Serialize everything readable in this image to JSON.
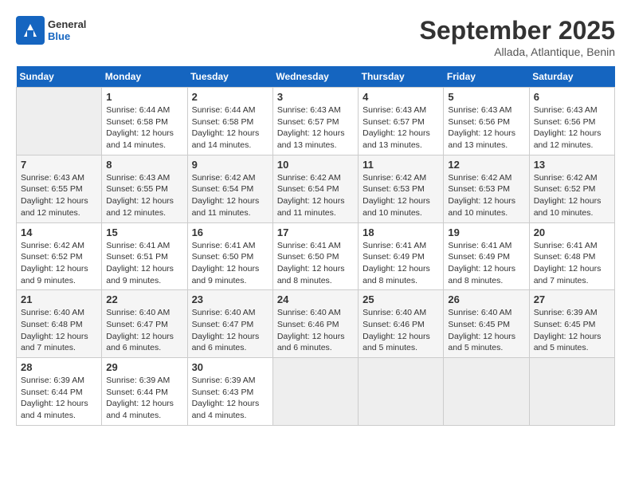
{
  "header": {
    "logo_line1": "General",
    "logo_line2": "Blue",
    "month": "September 2025",
    "location": "Allada, Atlantique, Benin"
  },
  "days_of_week": [
    "Sunday",
    "Monday",
    "Tuesday",
    "Wednesday",
    "Thursday",
    "Friday",
    "Saturday"
  ],
  "weeks": [
    [
      {
        "day": null
      },
      {
        "day": 1,
        "sunrise": "6:44 AM",
        "sunset": "6:58 PM",
        "daylight": "12 hours and 14 minutes."
      },
      {
        "day": 2,
        "sunrise": "6:44 AM",
        "sunset": "6:58 PM",
        "daylight": "12 hours and 14 minutes."
      },
      {
        "day": 3,
        "sunrise": "6:43 AM",
        "sunset": "6:57 PM",
        "daylight": "12 hours and 13 minutes."
      },
      {
        "day": 4,
        "sunrise": "6:43 AM",
        "sunset": "6:57 PM",
        "daylight": "12 hours and 13 minutes."
      },
      {
        "day": 5,
        "sunrise": "6:43 AM",
        "sunset": "6:56 PM",
        "daylight": "12 hours and 13 minutes."
      },
      {
        "day": 6,
        "sunrise": "6:43 AM",
        "sunset": "6:56 PM",
        "daylight": "12 hours and 12 minutes."
      }
    ],
    [
      {
        "day": 7,
        "sunrise": "6:43 AM",
        "sunset": "6:55 PM",
        "daylight": "12 hours and 12 minutes."
      },
      {
        "day": 8,
        "sunrise": "6:43 AM",
        "sunset": "6:55 PM",
        "daylight": "12 hours and 12 minutes."
      },
      {
        "day": 9,
        "sunrise": "6:42 AM",
        "sunset": "6:54 PM",
        "daylight": "12 hours and 11 minutes."
      },
      {
        "day": 10,
        "sunrise": "6:42 AM",
        "sunset": "6:54 PM",
        "daylight": "12 hours and 11 minutes."
      },
      {
        "day": 11,
        "sunrise": "6:42 AM",
        "sunset": "6:53 PM",
        "daylight": "12 hours and 10 minutes."
      },
      {
        "day": 12,
        "sunrise": "6:42 AM",
        "sunset": "6:53 PM",
        "daylight": "12 hours and 10 minutes."
      },
      {
        "day": 13,
        "sunrise": "6:42 AM",
        "sunset": "6:52 PM",
        "daylight": "12 hours and 10 minutes."
      }
    ],
    [
      {
        "day": 14,
        "sunrise": "6:42 AM",
        "sunset": "6:52 PM",
        "daylight": "12 hours and 9 minutes."
      },
      {
        "day": 15,
        "sunrise": "6:41 AM",
        "sunset": "6:51 PM",
        "daylight": "12 hours and 9 minutes."
      },
      {
        "day": 16,
        "sunrise": "6:41 AM",
        "sunset": "6:50 PM",
        "daylight": "12 hours and 9 minutes."
      },
      {
        "day": 17,
        "sunrise": "6:41 AM",
        "sunset": "6:50 PM",
        "daylight": "12 hours and 8 minutes."
      },
      {
        "day": 18,
        "sunrise": "6:41 AM",
        "sunset": "6:49 PM",
        "daylight": "12 hours and 8 minutes."
      },
      {
        "day": 19,
        "sunrise": "6:41 AM",
        "sunset": "6:49 PM",
        "daylight": "12 hours and 8 minutes."
      },
      {
        "day": 20,
        "sunrise": "6:41 AM",
        "sunset": "6:48 PM",
        "daylight": "12 hours and 7 minutes."
      }
    ],
    [
      {
        "day": 21,
        "sunrise": "6:40 AM",
        "sunset": "6:48 PM",
        "daylight": "12 hours and 7 minutes."
      },
      {
        "day": 22,
        "sunrise": "6:40 AM",
        "sunset": "6:47 PM",
        "daylight": "12 hours and 6 minutes."
      },
      {
        "day": 23,
        "sunrise": "6:40 AM",
        "sunset": "6:47 PM",
        "daylight": "12 hours and 6 minutes."
      },
      {
        "day": 24,
        "sunrise": "6:40 AM",
        "sunset": "6:46 PM",
        "daylight": "12 hours and 6 minutes."
      },
      {
        "day": 25,
        "sunrise": "6:40 AM",
        "sunset": "6:46 PM",
        "daylight": "12 hours and 5 minutes."
      },
      {
        "day": 26,
        "sunrise": "6:40 AM",
        "sunset": "6:45 PM",
        "daylight": "12 hours and 5 minutes."
      },
      {
        "day": 27,
        "sunrise": "6:39 AM",
        "sunset": "6:45 PM",
        "daylight": "12 hours and 5 minutes."
      }
    ],
    [
      {
        "day": 28,
        "sunrise": "6:39 AM",
        "sunset": "6:44 PM",
        "daylight": "12 hours and 4 minutes."
      },
      {
        "day": 29,
        "sunrise": "6:39 AM",
        "sunset": "6:44 PM",
        "daylight": "12 hours and 4 minutes."
      },
      {
        "day": 30,
        "sunrise": "6:39 AM",
        "sunset": "6:43 PM",
        "daylight": "12 hours and 4 minutes."
      },
      {
        "day": null
      },
      {
        "day": null
      },
      {
        "day": null
      },
      {
        "day": null
      }
    ]
  ]
}
